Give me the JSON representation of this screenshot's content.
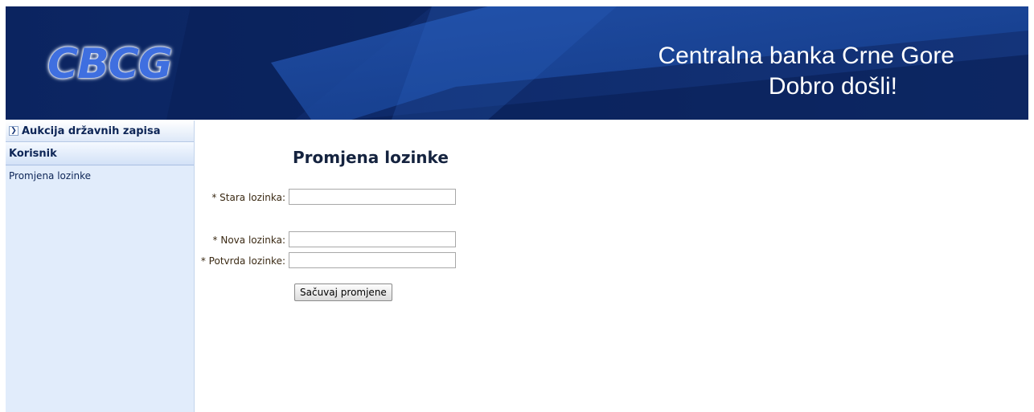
{
  "header": {
    "logo_text": "CBCG",
    "title": "Centralna banka Crne Gore",
    "welcome": "Dobro došli!"
  },
  "sidebar": {
    "sections": [
      {
        "label": "Aukcija državnih zapisa",
        "collapsed": true
      },
      {
        "label": "Korisnik",
        "items": [
          {
            "label": "Promjena lozinke"
          }
        ]
      }
    ]
  },
  "form": {
    "title": "Promjena lozinke",
    "fields": [
      {
        "label": "* Stara lozinka:",
        "value": ""
      },
      {
        "label": "* Nova lozinka:",
        "value": ""
      },
      {
        "label": "* Potvrda lozinke:",
        "value": ""
      }
    ],
    "submit_label": "Sačuvaj promjene"
  },
  "colors": {
    "banner_dark": "#0d2a63",
    "banner_light": "#1e4fa8",
    "sidebar_bg": "#e1ecfb",
    "label_text": "#3b2a14"
  }
}
